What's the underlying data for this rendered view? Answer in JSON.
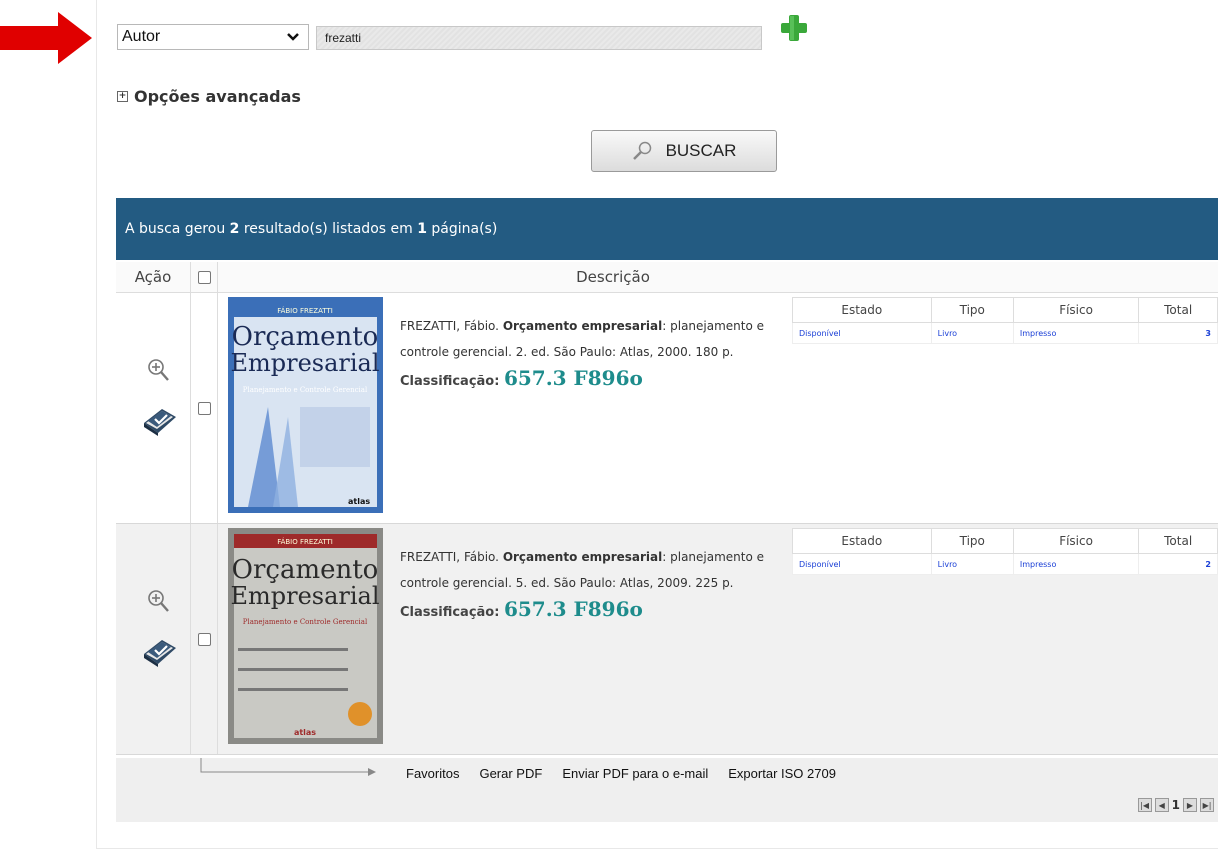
{
  "search": {
    "field_selected": "Autor",
    "query_value": "frezatti",
    "advanced_label": "Opções avançadas",
    "buscar_label": "BUSCAR"
  },
  "results_header": {
    "prefix": "A busca gerou ",
    "count": "2",
    "middle": " resultado(s) listados em ",
    "pages": "1",
    "suffix": " página(s)"
  },
  "table_header": {
    "acao": "Ação",
    "descricao": "Descrição"
  },
  "exemplar_headers": [
    "Estado",
    "Tipo",
    "Físico",
    "Total"
  ],
  "results": [
    {
      "cover": {
        "author": "FÁBIO FREZATTI",
        "title1": "Orçamento",
        "title2": "Empresarial",
        "subtitle": "Planejamento e Controle Gerencial",
        "publisher": "atlas"
      },
      "author": "FREZATTI, Fábio. ",
      "title": "Orçamento empresarial",
      "rest1": ": planejamento e controle gerencial. 2. ed. São Paulo: Atlas, 2000. 180 p.",
      "classif_label": "Classificação: ",
      "classif_value": "657.3 F896o",
      "exemplar": {
        "estado": "Disponível",
        "tipo": "Livro",
        "fisico": "Impresso",
        "total": "3"
      }
    },
    {
      "cover": {
        "author": "FÁBIO FREZATTI",
        "title1": "Orçamento",
        "title2": "Empresarial",
        "subtitle": "Planejamento e Controle Gerencial",
        "publisher": "atlas"
      },
      "author": "FREZATTI, Fábio. ",
      "title": "Orçamento empresarial",
      "rest1": ": planejamento e controle gerencial. 5. ed. São Paulo: Atlas, 2009. 225 p.",
      "classif_label": "Classificação: ",
      "classif_value": "657.3 F896o",
      "exemplar": {
        "estado": "Disponível",
        "tipo": "Livro",
        "fisico": "Impresso",
        "total": "2"
      }
    }
  ],
  "footer": {
    "links": [
      "Favoritos",
      "Gerar PDF",
      "Enviar PDF para o e-mail",
      "Exportar ISO 2709"
    ],
    "page_current": "1"
  },
  "colors": {
    "header_bar": "#235b82",
    "classification": "#1e8c8c",
    "link_blue": "#1a3fd6",
    "arrow_red": "#e00000",
    "plus_green": "#3aa83a"
  },
  "icons": [
    "red-arrow-icon",
    "chevron-down-icon",
    "add-field-icon",
    "expand-box-icon",
    "magnifier-icon",
    "zoom-in-icon",
    "book-check-icon",
    "first-page-icon",
    "prev-page-icon",
    "next-page-icon",
    "last-page-icon"
  ]
}
